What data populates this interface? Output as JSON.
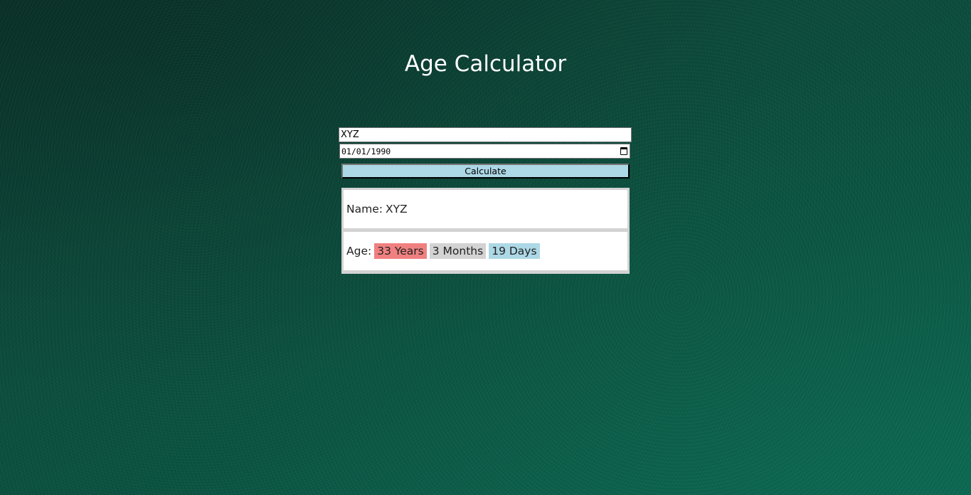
{
  "page": {
    "title": "Age Calculator"
  },
  "form": {
    "name_value": "XYZ",
    "dob_value": "01/01/1990",
    "calculate_label": "Calculate"
  },
  "result": {
    "name_label": "Name:",
    "name_value": "XYZ",
    "age_label": "Age:",
    "years": "33 Years",
    "months": "3 Months",
    "days": "19 Days"
  },
  "colors": {
    "background": "#0a4a3a",
    "button": "#add8e6",
    "years_chip": "#f08080",
    "months_chip": "#d3d3d3",
    "days_chip": "#add8e6"
  },
  "icons": {
    "date_picker": "calendar-icon"
  }
}
